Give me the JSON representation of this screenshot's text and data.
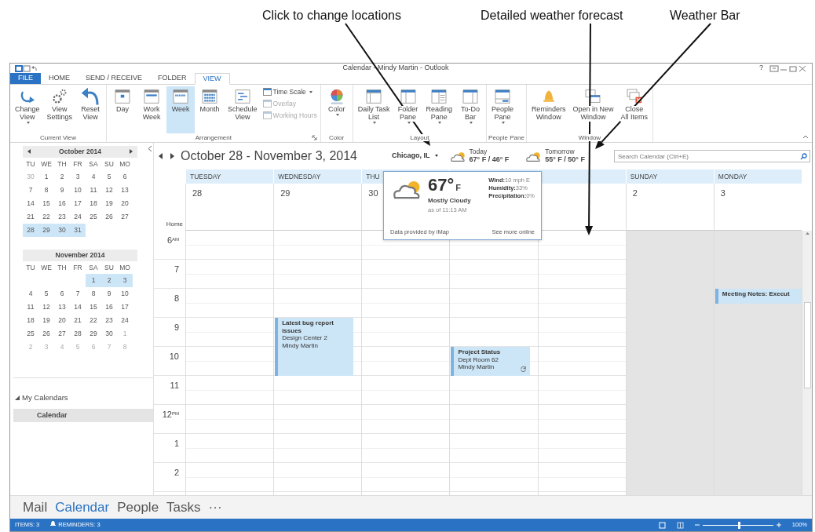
{
  "callouts": [
    {
      "text": "Click to change locations"
    },
    {
      "text": "Detailed weather forecast"
    },
    {
      "text": "Weather Bar"
    }
  ],
  "window": {
    "title": "Calendar - Mindy Martin - Outlook",
    "help": "?"
  },
  "tabs": [
    {
      "label": "FILE",
      "kind": "file",
      "selected": false
    },
    {
      "label": "HOME",
      "kind": "tab",
      "selected": false
    },
    {
      "label": "SEND / RECEIVE",
      "kind": "tab",
      "selected": false
    },
    {
      "label": "FOLDER",
      "kind": "tab",
      "selected": false
    },
    {
      "label": "VIEW",
      "kind": "tab",
      "selected": true
    }
  ],
  "ribbon": {
    "groups": [
      {
        "label": "Current View",
        "launcher": false,
        "items": [
          {
            "kind": "large",
            "label": "Change\nView",
            "dropdown": true,
            "selected": false
          },
          {
            "kind": "large",
            "label": "View\nSettings",
            "dropdown": false,
            "selected": false
          },
          {
            "kind": "large",
            "label": "Reset\nView",
            "dropdown": false,
            "selected": false
          }
        ]
      },
      {
        "label": "Arrangement",
        "launcher": true,
        "items": [
          {
            "kind": "large",
            "label": "Day",
            "dropdown": false,
            "selected": false
          },
          {
            "kind": "large",
            "label": "Work\nWeek",
            "dropdown": false,
            "selected": false
          },
          {
            "kind": "large",
            "label": "Week",
            "dropdown": false,
            "selected": true
          },
          {
            "kind": "large",
            "label": "Month",
            "dropdown": false,
            "selected": false
          },
          {
            "kind": "large",
            "label": "Schedule\nView",
            "dropdown": false,
            "selected": false
          },
          {
            "kind": "small",
            "label": "Time Scale",
            "dropdown": true,
            "disabled": false
          },
          {
            "kind": "small",
            "label": "Overlay",
            "dropdown": false,
            "disabled": true
          },
          {
            "kind": "small",
            "label": "Working Hours",
            "dropdown": false,
            "disabled": true
          }
        ]
      },
      {
        "label": "Color",
        "launcher": false,
        "items": [
          {
            "kind": "large",
            "label": "Color",
            "dropdown": true,
            "selected": false
          }
        ]
      },
      {
        "label": "Layout",
        "launcher": false,
        "items": [
          {
            "kind": "large",
            "label": "Daily Task\nList",
            "dropdown": true,
            "selected": false
          },
          {
            "kind": "large",
            "label": "Folder\nPane",
            "dropdown": true,
            "selected": false
          },
          {
            "kind": "large",
            "label": "Reading\nPane",
            "dropdown": true,
            "selected": false
          },
          {
            "kind": "large",
            "label": "To-Do\nBar",
            "dropdown": true,
            "selected": false
          }
        ]
      },
      {
        "label": "People Pane",
        "launcher": false,
        "items": [
          {
            "kind": "large",
            "label": "People\nPane",
            "dropdown": true,
            "selected": false
          }
        ]
      },
      {
        "label": "Window",
        "launcher": false,
        "items": [
          {
            "kind": "large",
            "label": "Reminders\nWindow",
            "dropdown": false,
            "selected": false
          },
          {
            "kind": "large",
            "label": "Open in New\nWindow",
            "dropdown": false,
            "selected": false
          },
          {
            "kind": "large",
            "label": "Close\nAll Items",
            "dropdown": false,
            "selected": false
          }
        ]
      }
    ]
  },
  "left_pane": {
    "months": [
      {
        "title": "October 2014",
        "arrows": true,
        "weekdays": [
          "TU",
          "WE",
          "TH",
          "FR",
          "SA",
          "SU",
          "MO"
        ],
        "weeks": [
          {
            "days": [
              {
                "d": "30",
                "selected": false,
                "muted": true
              },
              {
                "d": "1",
                "selected": false,
                "muted": false
              },
              {
                "d": "2",
                "selected": false,
                "muted": false
              },
              {
                "d": "3",
                "selected": false,
                "muted": false
              },
              {
                "d": "4",
                "selected": false,
                "muted": false
              },
              {
                "d": "5",
                "selected": false,
                "muted": false
              },
              {
                "d": "6",
                "selected": false,
                "muted": false
              }
            ]
          },
          {
            "days": [
              {
                "d": "7",
                "selected": false,
                "muted": false
              },
              {
                "d": "8",
                "selected": false,
                "muted": false
              },
              {
                "d": "9",
                "selected": false,
                "muted": false
              },
              {
                "d": "10",
                "selected": false,
                "muted": false
              },
              {
                "d": "11",
                "selected": false,
                "muted": false
              },
              {
                "d": "12",
                "selected": false,
                "muted": false
              },
              {
                "d": "13",
                "selected": false,
                "muted": false
              }
            ]
          },
          {
            "days": [
              {
                "d": "14",
                "selected": false,
                "muted": false
              },
              {
                "d": "15",
                "selected": false,
                "muted": false
              },
              {
                "d": "16",
                "selected": false,
                "muted": false
              },
              {
                "d": "17",
                "selected": false,
                "muted": false
              },
              {
                "d": "18",
                "selected": false,
                "muted": false
              },
              {
                "d": "19",
                "selected": false,
                "muted": false
              },
              {
                "d": "20",
                "selected": false,
                "muted": false
              }
            ]
          },
          {
            "days": [
              {
                "d": "21",
                "selected": false,
                "muted": false
              },
              {
                "d": "22",
                "selected": false,
                "muted": false
              },
              {
                "d": "23",
                "selected": false,
                "muted": false
              },
              {
                "d": "24",
                "selected": false,
                "muted": false
              },
              {
                "d": "25",
                "selected": false,
                "muted": false
              },
              {
                "d": "26",
                "selected": false,
                "muted": false
              },
              {
                "d": "27",
                "selected": false,
                "muted": false
              }
            ]
          },
          {
            "days": [
              {
                "d": "28",
                "selected": true,
                "muted": false
              },
              {
                "d": "29",
                "selected": true,
                "muted": false
              },
              {
                "d": "30",
                "selected": true,
                "muted": false
              },
              {
                "d": "31",
                "selected": true,
                "muted": false
              }
            ]
          }
        ]
      },
      {
        "title": "November 2014",
        "arrows": false,
        "weekdays": [
          "TU",
          "WE",
          "TH",
          "FR",
          "SA",
          "SU",
          "MO"
        ],
        "weeks": [
          {
            "days": [
              {
                "d": "1",
                "selected": true,
                "muted": false
              },
              {
                "d": "2",
                "selected": true,
                "muted": false
              },
              {
                "d": "3",
                "selected": true,
                "muted": false
              }
            ]
          },
          {
            "days": [
              {
                "d": "4",
                "selected": false,
                "muted": false
              },
              {
                "d": "5",
                "selected": false,
                "muted": false
              },
              {
                "d": "6",
                "selected": false,
                "muted": false
              },
              {
                "d": "7",
                "selected": false,
                "muted": false
              },
              {
                "d": "8",
                "selected": false,
                "muted": false
              },
              {
                "d": "9",
                "selected": false,
                "muted": false
              },
              {
                "d": "10",
                "selected": false,
                "muted": false
              }
            ]
          },
          {
            "days": [
              {
                "d": "11",
                "selected": false,
                "muted": false
              },
              {
                "d": "12",
                "selected": false,
                "muted": false
              },
              {
                "d": "13",
                "selected": false,
                "muted": false
              },
              {
                "d": "14",
                "selected": false,
                "muted": false
              },
              {
                "d": "15",
                "selected": false,
                "muted": false
              },
              {
                "d": "16",
                "selected": false,
                "muted": false
              },
              {
                "d": "17",
                "selected": false,
                "muted": false
              }
            ]
          },
          {
            "days": [
              {
                "d": "18",
                "selected": false,
                "muted": false
              },
              {
                "d": "19",
                "selected": false,
                "muted": false
              },
              {
                "d": "20",
                "selected": false,
                "muted": false
              },
              {
                "d": "21",
                "selected": false,
                "muted": false
              },
              {
                "d": "22",
                "selected": false,
                "muted": false
              },
              {
                "d": "23",
                "selected": false,
                "muted": false
              },
              {
                "d": "24",
                "selected": false,
                "muted": false
              }
            ]
          },
          {
            "days": [
              {
                "d": "25",
                "selected": false,
                "muted": false
              },
              {
                "d": "26",
                "selected": false,
                "muted": false
              },
              {
                "d": "27",
                "selected": false,
                "muted": false
              },
              {
                "d": "28",
                "selected": false,
                "muted": false
              },
              {
                "d": "29",
                "selected": false,
                "muted": false
              },
              {
                "d": "30",
                "selected": false,
                "muted": false
              },
              {
                "d": "1",
                "selected": false,
                "muted": true
              }
            ]
          },
          {
            "days": [
              {
                "d": "2",
                "selected": false,
                "muted": true
              },
              {
                "d": "3",
                "selected": false,
                "muted": true
              },
              {
                "d": "4",
                "selected": false,
                "muted": true
              },
              {
                "d": "5",
                "selected": false,
                "muted": true
              },
              {
                "d": "6",
                "selected": false,
                "muted": true
              },
              {
                "d": "7",
                "selected": false,
                "muted": true
              },
              {
                "d": "8",
                "selected": false,
                "muted": true
              }
            ]
          }
        ]
      }
    ],
    "folders": {
      "label": "My Calendars",
      "expanded": true,
      "items": [
        {
          "label": "Calendar",
          "selected": true
        }
      ]
    }
  },
  "calendar": {
    "range": "October 28 - November 3, 2014",
    "location": "Chicago, IL",
    "today": {
      "label": "Today",
      "temps": "67° F / 46° F"
    },
    "tomorrow": {
      "label": "Tomorrow",
      "temps": "55° F / 50° F"
    },
    "search": {
      "placeholder": "Search Calendar (Ctrl+E)"
    },
    "home_label": "Home",
    "days": [
      {
        "name": "TUESDAY",
        "date": "28",
        "nonworking": false
      },
      {
        "name": "WEDNESDAY",
        "date": "29",
        "nonworking": false,
        "events": [
          {
            "kind": "h9to11",
            "title": "Latest bug report issues",
            "location": "Design Center 2",
            "organizer": "Mindy Martin",
            "recurring": false
          }
        ]
      },
      {
        "name": "THU",
        "date": "30",
        "nonworking": false
      },
      {
        "nonworking": false,
        "events": [
          {
            "kind": "h10to11",
            "title": "Project Status",
            "location": "Dept Room 62",
            "organizer": "Mindy Martin",
            "recurring": true
          }
        ]
      },
      {
        "nonworking": false
      },
      {
        "name": "SUNDAY",
        "date": "2",
        "nonworking": true
      },
      {
        "name": "MONDAY",
        "date": "3",
        "nonworking": true,
        "events": [
          {
            "kind": "h8to830",
            "title": "Meeting Notes: Execut",
            "recurring": false
          }
        ]
      }
    ],
    "hours": [
      "6$^{AM}$",
      "7",
      "8",
      "9",
      "10",
      "11",
      "12$^{PM}$",
      "1",
      "2"
    ],
    "popup": {
      "temp": "67°",
      "unit": "F",
      "condition": "Mostly Cloudy",
      "as_of": "as of 11:13 AM",
      "details": [
        {
          "label": "Wind:",
          "value": "10 mph E"
        },
        {
          "label": "Humidity:",
          "value": "33%"
        },
        {
          "label": "Precipitation:",
          "value": "0%"
        }
      ],
      "source": "Data provided by iMap",
      "link": "See more online"
    }
  },
  "nav": [
    {
      "label": "Mail",
      "selected": false
    },
    {
      "label": "Calendar",
      "selected": true
    },
    {
      "label": "People",
      "selected": false
    },
    {
      "label": "Tasks",
      "selected": false
    },
    {
      "label": "···",
      "selected": false
    }
  ],
  "status_bar": {
    "items": "ITEMS: 3",
    "reminders": "REMINDERS: 3",
    "zoom": {
      "level": 0.5,
      "reading": "100%"
    }
  }
}
